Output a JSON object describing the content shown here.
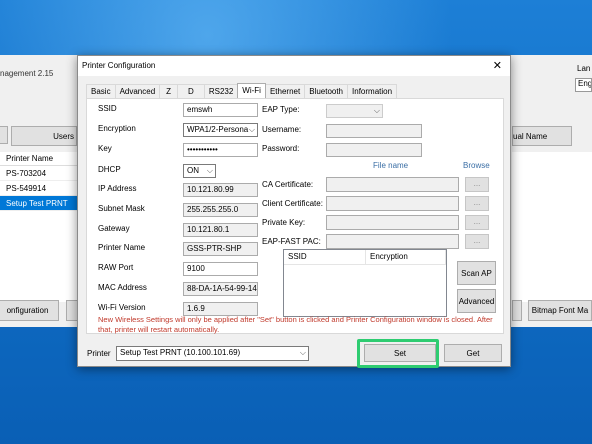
{
  "background_app": {
    "title": "nagement 2.15",
    "users_button": "Users",
    "printer_list": {
      "header": "Printer Name",
      "rows": [
        "PS-703204",
        "PS-549914",
        "Setup Test PRNT"
      ],
      "selected_index": 2
    },
    "configuration_button": "onfiguration",
    "manual_name_button": "ual Name",
    "lang_label": "Lan",
    "lang_value": "Engl",
    "bitmap_font_button": "Bitmap Font Ma"
  },
  "dialog": {
    "title": "Printer Configuration",
    "close_glyph": "✕",
    "tabs": [
      {
        "label": "Basic"
      },
      {
        "label": "Advanced"
      },
      {
        "label": "Z"
      },
      {
        "label": "D"
      },
      {
        "label": "RS232"
      },
      {
        "label": "Wi-Fi"
      },
      {
        "label": "Ethernet"
      },
      {
        "label": "Bluetooth"
      },
      {
        "label": "Information"
      }
    ],
    "active_tab": "Wi-Fi",
    "wifi": {
      "ssid": {
        "label": "SSID",
        "value": "emswh"
      },
      "encryption": {
        "label": "Encryption",
        "value": "WPA1/2-Persona"
      },
      "key": {
        "label": "Key",
        "value": "•••••••••••"
      },
      "dhcp": {
        "label": "DHCP",
        "value": "ON"
      },
      "ip_address": {
        "label": "IP Address",
        "value": "10.121.80.99"
      },
      "subnet_mask": {
        "label": "Subnet Mask",
        "value": "255.255.255.0"
      },
      "gateway": {
        "label": "Gateway",
        "value": "10.121.80.1"
      },
      "printer_name": {
        "label": "Printer Name",
        "value": "GSS-PTR-SHP"
      },
      "raw_port": {
        "label": "RAW Port",
        "value": "9100"
      },
      "mac_address": {
        "label": "MAC Address",
        "value": "88-DA-1A-54-99-14"
      },
      "wifi_version": {
        "label": "Wi-Fi Version",
        "value": "1.6.9"
      },
      "eap_type_label": "EAP Type:",
      "username_label": "Username:",
      "password_label": "Password:",
      "file_name_header": "File name",
      "browse_header": "Browse",
      "ca_certificate_label": "CA Certificate:",
      "client_certificate_label": "Client Certificate:",
      "private_key_label": "Private Key:",
      "eap_fast_pac_label": "EAP-FAST PAC:",
      "browse_button": "...",
      "scan_table": {
        "columns": [
          "SSID",
          "Encryption"
        ]
      },
      "scan_ap_button": "Scan AP",
      "advanced_button": "Advanced",
      "warning": "New Wireless Settings will only be applied after \"Set\" button is clicked and Printer Configuration window is closed. After that, printer will restart automatically."
    },
    "printer_label": "Printer",
    "printer_value": "Setup Test PRNT (10.100.101.69)",
    "set_button": "Set",
    "get_button": "Get"
  },
  "colors": {
    "accent_highlight": "#2ecc71",
    "warning_text": "#c0392b",
    "selection": "#0078d7"
  }
}
